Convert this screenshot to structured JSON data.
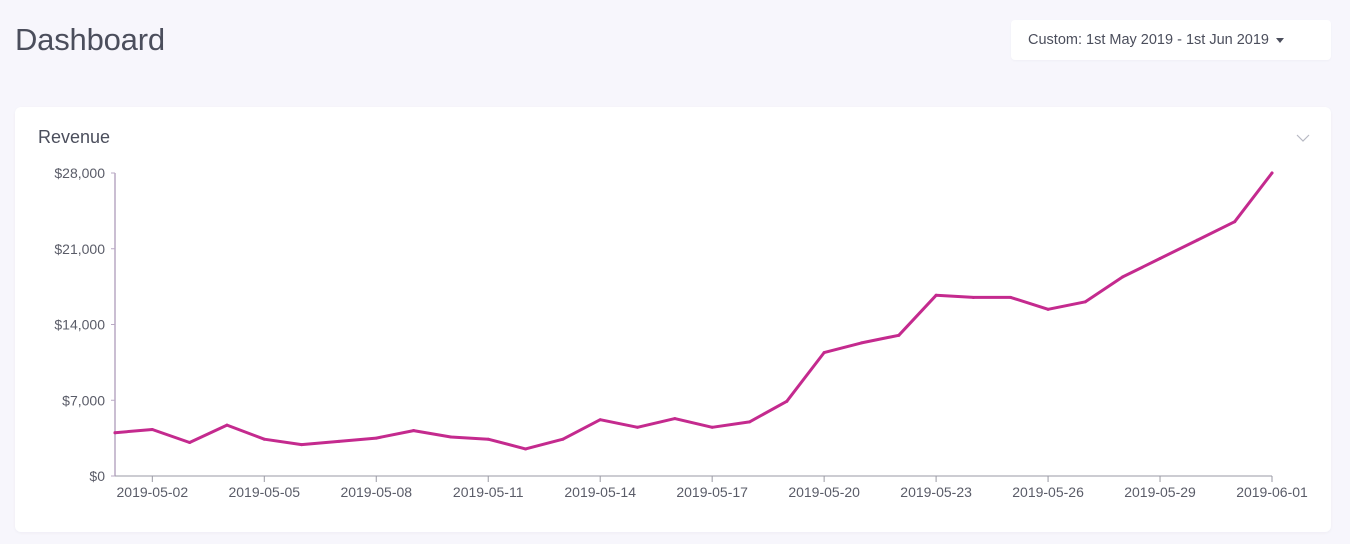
{
  "header": {
    "title": "Dashboard",
    "date_filter_label": "Custom: 1st May 2019 - 1st Jun 2019",
    "date_filter_icon": "caret-down-icon"
  },
  "card": {
    "title": "Revenue",
    "toggle_icon": "chevron-down-icon"
  },
  "colors": {
    "line": "#c42a8e",
    "axis": "#b9a9c4",
    "text": "#5a5c68"
  },
  "chart_data": {
    "type": "line",
    "title": "Revenue",
    "xlabel": "",
    "ylabel": "",
    "grid": false,
    "ylim": [
      0,
      28000
    ],
    "y_ticks": [
      0,
      7000,
      14000,
      21000,
      28000
    ],
    "y_tick_labels": [
      "$0",
      "$7,000",
      "$14,000",
      "$21,000",
      "$28,000"
    ],
    "x_tick_labels": [
      "2019-05-02",
      "2019-05-05",
      "2019-05-08",
      "2019-05-11",
      "2019-05-14",
      "2019-05-17",
      "2019-05-20",
      "2019-05-23",
      "2019-05-26",
      "2019-05-29",
      "2019-06-01"
    ],
    "x": [
      "2019-05-01",
      "2019-05-02",
      "2019-05-03",
      "2019-05-04",
      "2019-05-05",
      "2019-05-06",
      "2019-05-07",
      "2019-05-08",
      "2019-05-09",
      "2019-05-10",
      "2019-05-11",
      "2019-05-12",
      "2019-05-13",
      "2019-05-14",
      "2019-05-15",
      "2019-05-16",
      "2019-05-17",
      "2019-05-18",
      "2019-05-19",
      "2019-05-20",
      "2019-05-21",
      "2019-05-22",
      "2019-05-23",
      "2019-05-24",
      "2019-05-25",
      "2019-05-26",
      "2019-05-27",
      "2019-05-28",
      "2019-05-29",
      "2019-05-30",
      "2019-05-31",
      "2019-06-01"
    ],
    "series": [
      {
        "values": [
          4000,
          4300,
          3100,
          4700,
          3400,
          2900,
          3200,
          3500,
          4200,
          3600,
          3400,
          2500,
          3400,
          5200,
          4500,
          5300,
          4500,
          5000,
          6900,
          11400,
          12300,
          13000,
          16700,
          16500,
          16500,
          15400,
          16100,
          18400,
          20100,
          21800,
          23500,
          28000
        ]
      }
    ]
  }
}
